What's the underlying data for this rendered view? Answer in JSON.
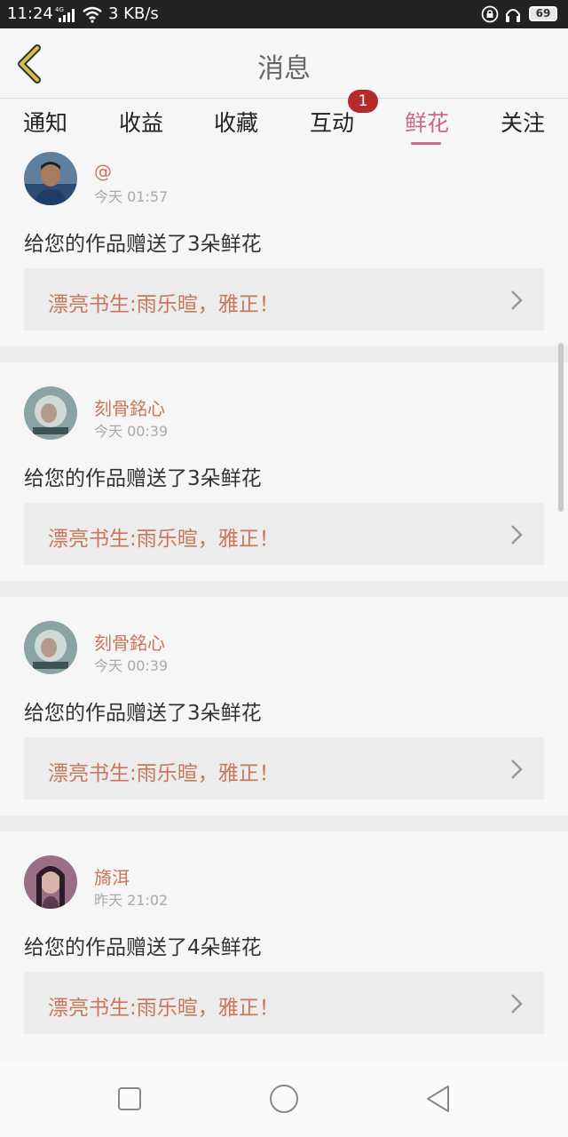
{
  "status_bar": {
    "time": "11:24",
    "network": "4G",
    "speed": "3 KB/s",
    "battery": "69"
  },
  "header": {
    "title": "消息"
  },
  "tabs": [
    {
      "label": "通知"
    },
    {
      "label": "收益"
    },
    {
      "label": "收藏"
    },
    {
      "label": "互动",
      "badge": "1"
    },
    {
      "label": "鲜花",
      "active": true
    },
    {
      "label": "关注"
    }
  ],
  "messages": [
    {
      "name": "@",
      "time": "今天 01:57",
      "text": "给您的作品赠送了3朵鲜花",
      "work_title": "漂亮书生:雨乐暄，雅正！"
    },
    {
      "name": "刻骨銘心",
      "time": "今天 00:39",
      "text": "给您的作品赠送了3朵鲜花",
      "work_title": "漂亮书生:雨乐暄，雅正！"
    },
    {
      "name": "刻骨銘心",
      "time": "今天 00:39",
      "text": "给您的作品赠送了3朵鲜花",
      "work_title": "漂亮书生:雨乐暄，雅正！"
    },
    {
      "name": "旖洱",
      "time": "昨天 21:02",
      "text": "给您的作品赠送了4朵鲜花",
      "work_title": "漂亮书生:雨乐暄，雅正！"
    }
  ],
  "colors": {
    "accent": "#c86b8a",
    "name_orange": "#c8775a",
    "badge_red": "#b52a2a"
  },
  "icons": {
    "back": "chevron-left-icon",
    "work_arrow": "chevron-right-icon",
    "nav_recent": "square-icon",
    "nav_home": "circle-icon",
    "nav_back": "triangle-back-icon"
  }
}
